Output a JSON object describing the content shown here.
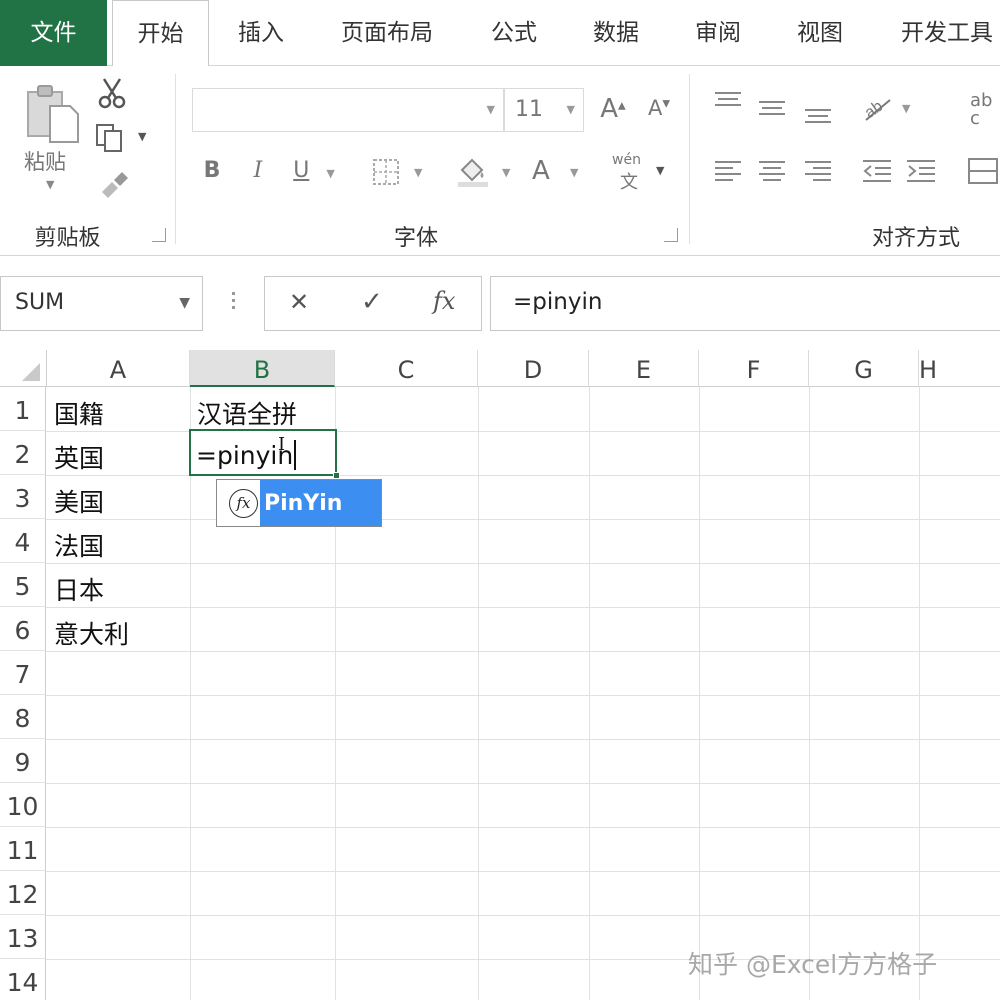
{
  "tabs": [
    "文件",
    "开始",
    "插入",
    "页面布局",
    "公式",
    "数据",
    "审阅",
    "视图",
    "开发工具"
  ],
  "active_tab": "开始",
  "ribbon": {
    "clipboard": {
      "paste_label": "粘贴",
      "group_label": "剪贴板"
    },
    "font": {
      "font_name": "",
      "font_size": "11",
      "group_label": "字体",
      "bold": "B",
      "italic": "I",
      "underline": "U",
      "font_color_glyph": "A",
      "grow_font": "A",
      "shrink_font": "A",
      "phonetic_top": "wén",
      "phonetic_bottom": "文"
    },
    "alignment": {
      "group_label": "对齐方式",
      "wrap_top": "ab",
      "wrap_bottom": "c"
    }
  },
  "formula_bar": {
    "name_box": "SUM",
    "cancel": "✕",
    "enter": "✓",
    "fx": "fx",
    "content": "=pinyin"
  },
  "grid": {
    "columns": [
      "A",
      "B",
      "C",
      "D",
      "E",
      "F",
      "G",
      "H"
    ],
    "selected_column": "B",
    "rows": [
      "1",
      "2",
      "3",
      "4",
      "5",
      "6",
      "7",
      "8",
      "9",
      "10",
      "11",
      "12",
      "13",
      "14"
    ],
    "cells": {
      "A1": "国籍",
      "A2": "英国",
      "A3": "美国",
      "A4": "法国",
      "A5": "日本",
      "A6": "意大利",
      "B1": "汉语全拼"
    },
    "editing_cell": "B2",
    "editing_text": "=pinyin"
  },
  "autocomplete": {
    "items": [
      "PinYin"
    ]
  },
  "watermark": "知乎 @Excel方方格子",
  "colors": {
    "excel_green": "#217346",
    "highlight_blue": "#3c8ff0"
  }
}
